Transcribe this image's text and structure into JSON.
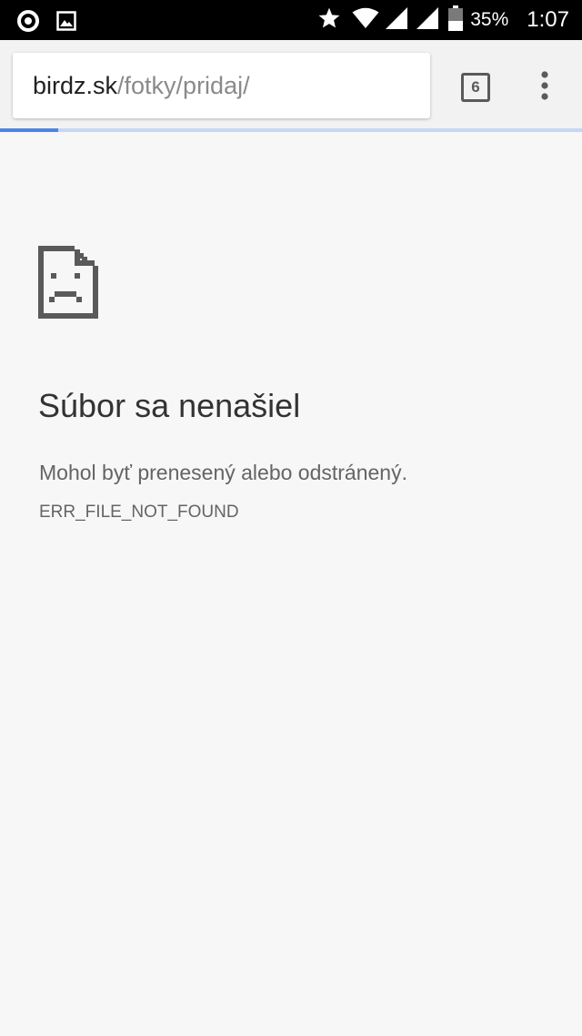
{
  "status_bar": {
    "battery_percent": "35%",
    "time": "1:07",
    "icons": [
      "record-icon",
      "image-icon",
      "star-icon",
      "wifi-icon",
      "signal-icon",
      "signal-icon",
      "battery-icon"
    ]
  },
  "toolbar": {
    "url_domain": "birdz.sk",
    "url_path": "/fotky/pridaj/",
    "tab_count": "6",
    "menu_icon": "more-vertical-icon"
  },
  "page_load": {
    "progress": 0.1
  },
  "error": {
    "icon": "sad-file-icon",
    "title": "Súbor sa nenašiel",
    "description": "Mohol byť prenesený alebo odstránený.",
    "code": "ERR_FILE_NOT_FOUND"
  },
  "colors": {
    "status_bar_bg": "#000000",
    "toolbar_bg": "#f2f2f2",
    "page_bg": "#f7f7f7",
    "progress_fill": "#4a86e8",
    "progress_track": "#c6d7f5",
    "title_text": "#333333",
    "secondary_text": "#646464"
  }
}
